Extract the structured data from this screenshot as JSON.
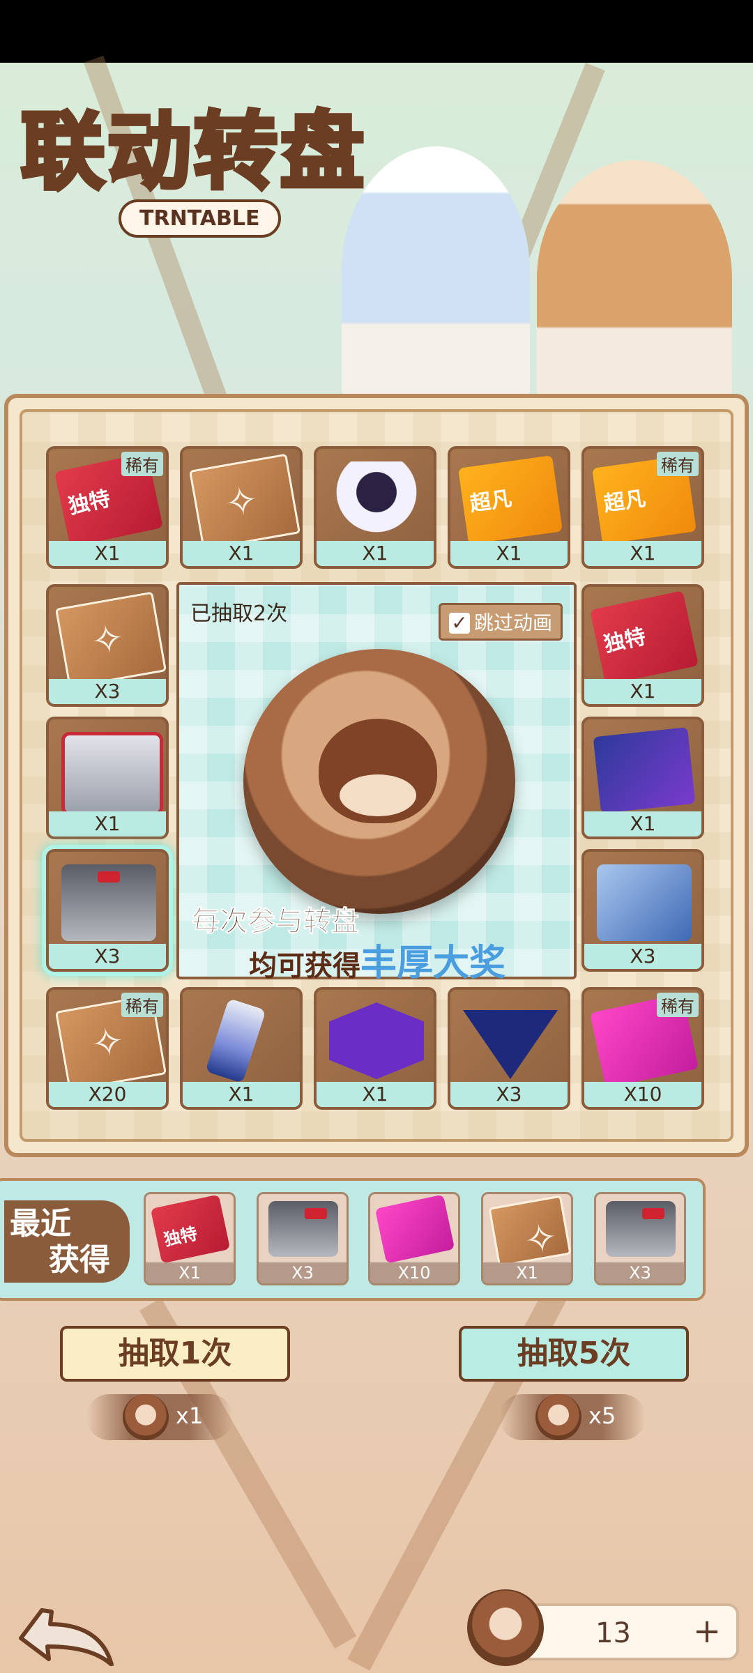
{
  "header": {
    "title": "联动转盘",
    "subtitle": "TRNTABLE"
  },
  "grid": {
    "items": [
      {
        "qty": "X1",
        "badge": "稀有",
        "icon": "ticket-red",
        "ticket_text": "独特"
      },
      {
        "qty": "X1",
        "badge": "",
        "icon": "brown-card"
      },
      {
        "qty": "X1",
        "badge": "",
        "icon": "robot"
      },
      {
        "qty": "X1",
        "badge": "",
        "icon": "ticket-orange",
        "ticket_text": "超凡"
      },
      {
        "qty": "X1",
        "badge": "稀有",
        "icon": "ticket-orange",
        "ticket_text": "超凡"
      },
      {
        "qty": "X3",
        "badge": "",
        "icon": "brown-card"
      },
      {
        "qty": "X1",
        "badge": "",
        "icon": "ticket-red",
        "ticket_text": "独特"
      },
      {
        "qty": "X1",
        "badge": "",
        "icon": "box-red"
      },
      {
        "qty": "X1",
        "badge": "",
        "icon": "folder"
      },
      {
        "qty": "X3",
        "badge": "",
        "icon": "box-dark"
      },
      {
        "qty": "X3",
        "badge": "",
        "icon": "case-blue"
      },
      {
        "qty": "X20",
        "badge": "稀有",
        "icon": "brown-card"
      },
      {
        "qty": "X1",
        "badge": "",
        "icon": "can"
      },
      {
        "qty": "X1",
        "badge": "",
        "icon": "hex-purple"
      },
      {
        "qty": "X3",
        "badge": "",
        "icon": "tri-dark"
      },
      {
        "qty": "X10",
        "badge": "稀有",
        "icon": "ticket-pink"
      }
    ]
  },
  "center": {
    "draw_count": "已抽取2次",
    "skip_label": "跳过动画",
    "promo_line1": "每次参与转盘",
    "promo_line2_prefix": "均可获得",
    "promo_line2_highlight": "丰厚大奖"
  },
  "recent": {
    "label_line1": "最近",
    "label_line2": "获得",
    "items": [
      {
        "qty": "X1",
        "icon": "ticket-red",
        "ticket_text": "独特"
      },
      {
        "qty": "X3",
        "icon": "box-dark"
      },
      {
        "qty": "X10",
        "icon": "ticket-pink"
      },
      {
        "qty": "X1",
        "icon": "brown-card"
      },
      {
        "qty": "X3",
        "icon": "box-dark"
      }
    ]
  },
  "actions": {
    "draw1_label": "抽取1次",
    "draw5_label": "抽取5次",
    "cost1": "x1",
    "cost5": "x5"
  },
  "footer": {
    "balance": "13",
    "plus": "+"
  }
}
